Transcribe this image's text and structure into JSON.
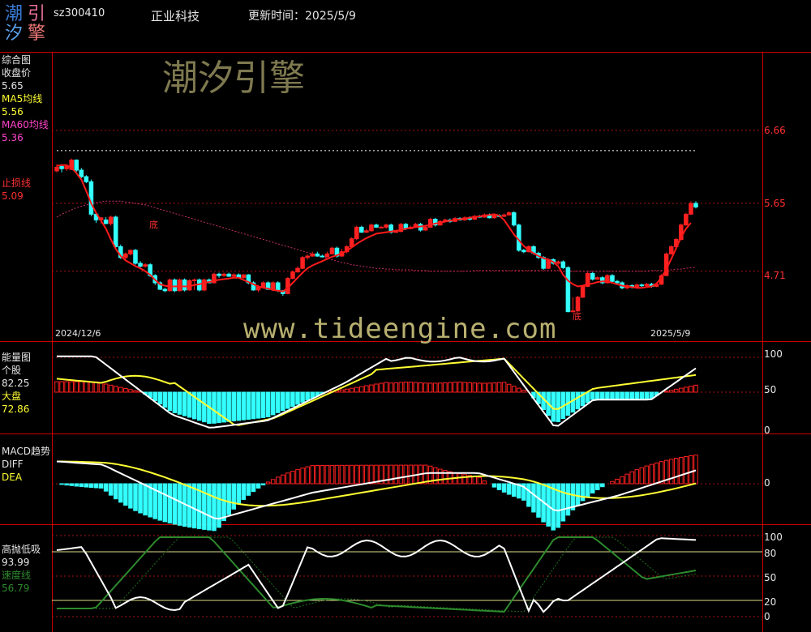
{
  "header": {
    "logo": {
      "c1": "潮",
      "c2": "引",
      "c3": "汐",
      "c4": "擎"
    },
    "code": "sz300410",
    "name": "正业科技",
    "update_label": "更新时间：2025/5/9"
  },
  "watermarks": {
    "brand": "潮汐引擎",
    "url": "www.tideengine.com"
  },
  "panels": {
    "main": {
      "title": "综合图",
      "close_label": "收盘价",
      "close_value": "5.65",
      "ma5_label": "MA5均线",
      "ma5_value": "5.56",
      "ma60_label": "MA60均线",
      "ma60_value": "5.36",
      "stop_label": "止损线",
      "stop_value": "5.09",
      "yticks": [
        "6.66",
        "5.65",
        "4.71"
      ],
      "date_start": "2024/12/6",
      "date_end": "2025/5/9",
      "bottom_marks": [
        "底",
        "底"
      ]
    },
    "energy": {
      "title": "能量图",
      "stock_label": "个股",
      "stock_value": "82.25",
      "market_label": "大盘",
      "market_value": "72.86",
      "yticks": [
        "100",
        "50",
        "0"
      ]
    },
    "macd": {
      "title": "MACD趋势",
      "diff_label": "DIFF",
      "dea_label": "DEA",
      "yticks": [
        "0"
      ]
    },
    "hilo": {
      "title": "高抛低吸",
      "value": "93.99",
      "speed_label": "速度线",
      "speed_value": "56.79",
      "yticks": [
        "100",
        "80",
        "50",
        "20",
        "0"
      ]
    }
  },
  "colors": {
    "bg": "#000000",
    "up": "#ff2020",
    "down": "#33ffff",
    "frame": "#cc0000",
    "white": "#ffffff",
    "yellow": "#ffff33",
    "green": "#2d8a2d",
    "magenta": "#ff44cc"
  },
  "chart_data": {
    "type": "candlestick",
    "x_range": [
      "2024/12/6",
      "2025/5/9"
    ],
    "y_ticks": [
      4.71,
      5.65,
      6.66
    ],
    "candles": [
      [
        6.1,
        6.15,
        6.19,
        6.08
      ],
      [
        6.16,
        6.13,
        6.19,
        6.08
      ],
      [
        6.13,
        6.16,
        6.19,
        6.1
      ],
      [
        6.12,
        6.25,
        6.27,
        6.11
      ],
      [
        6.25,
        6.11,
        6.26,
        6.08
      ],
      [
        6.11,
        6.02,
        6.14,
        6.0
      ],
      [
        6.02,
        5.95,
        6.04,
        5.93
      ],
      [
        5.95,
        5.5,
        5.98,
        5.47
      ],
      [
        5.5,
        5.42,
        5.53,
        5.38
      ],
      [
        5.42,
        5.45,
        5.46,
        5.37
      ],
      [
        5.42,
        5.37,
        5.46,
        5.36
      ],
      [
        5.37,
        5.46,
        5.48,
        5.34
      ],
      [
        5.46,
        5.05,
        5.48,
        5.03
      ],
      [
        5.05,
        4.9,
        5.08,
        4.88
      ],
      [
        4.9,
        4.95,
        4.97,
        4.86
      ],
      [
        4.95,
        5.0,
        5.01,
        4.93
      ],
      [
        5.0,
        4.82,
        5.02,
        4.8
      ],
      [
        4.82,
        4.78,
        4.85,
        4.75
      ],
      [
        4.78,
        4.8,
        4.82,
        4.76
      ],
      [
        4.8,
        4.65,
        4.82,
        4.63
      ],
      [
        4.65,
        4.55,
        4.67,
        4.52
      ],
      [
        4.55,
        4.46,
        4.57,
        4.45
      ],
      [
        4.46,
        4.44,
        4.48,
        4.42
      ],
      [
        4.44,
        4.59,
        4.61,
        4.43
      ],
      [
        4.59,
        4.44,
        4.61,
        4.42
      ],
      [
        4.44,
        4.59,
        4.61,
        4.43
      ],
      [
        4.59,
        4.45,
        4.61,
        4.43
      ],
      [
        4.45,
        4.58,
        4.6,
        4.44
      ],
      [
        4.58,
        4.59,
        4.61,
        4.45
      ],
      [
        4.59,
        4.45,
        4.61,
        4.43
      ],
      [
        4.45,
        4.59,
        4.61,
        4.43
      ],
      [
        4.59,
        4.55,
        4.61,
        4.54
      ],
      [
        4.55,
        4.67,
        4.69,
        4.54
      ],
      [
        4.67,
        4.65,
        4.69,
        4.62
      ],
      [
        4.65,
        4.67,
        4.69,
        4.63
      ],
      [
        4.67,
        4.64,
        4.69,
        4.63
      ],
      [
        4.64,
        4.66,
        4.68,
        4.62
      ],
      [
        4.66,
        4.62,
        4.68,
        4.61
      ],
      [
        4.62,
        4.66,
        4.67,
        4.61
      ],
      [
        4.66,
        4.55,
        4.67,
        4.53
      ],
      [
        4.55,
        4.45,
        4.57,
        4.44
      ],
      [
        4.45,
        4.49,
        4.52,
        4.42
      ],
      [
        4.49,
        4.55,
        4.57,
        4.48
      ],
      [
        4.55,
        4.46,
        4.57,
        4.45
      ],
      [
        4.46,
        4.55,
        4.57,
        4.44
      ],
      [
        4.55,
        4.44,
        4.57,
        4.42
      ],
      [
        4.44,
        4.4,
        4.45,
        4.37
      ],
      [
        4.4,
        4.61,
        4.63,
        4.39
      ],
      [
        4.61,
        4.7,
        4.72,
        4.6
      ],
      [
        4.7,
        4.75,
        4.78,
        4.69
      ],
      [
        4.75,
        4.9,
        4.92,
        4.74
      ],
      [
        4.9,
        4.92,
        4.94,
        4.87
      ],
      [
        4.92,
        4.95,
        4.98,
        4.91
      ],
      [
        4.95,
        4.92,
        4.98,
        4.91
      ],
      [
        4.92,
        4.91,
        4.94,
        4.9
      ],
      [
        4.91,
        4.95,
        4.98,
        4.9
      ],
      [
        4.95,
        5.03,
        5.05,
        4.94
      ],
      [
        5.03,
        4.92,
        5.05,
        4.9
      ],
      [
        4.92,
        4.98,
        5.02,
        4.91
      ],
      [
        4.98,
        5.05,
        5.07,
        4.96
      ],
      [
        5.05,
        5.16,
        5.18,
        5.03
      ],
      [
        5.16,
        5.32,
        5.34,
        5.14
      ],
      [
        5.32,
        5.25,
        5.34,
        5.24
      ],
      [
        5.25,
        5.27,
        5.3,
        5.24
      ],
      [
        5.27,
        5.35,
        5.37,
        5.26
      ],
      [
        5.35,
        5.32,
        5.37,
        5.31
      ],
      [
        5.32,
        5.32,
        5.34,
        5.31
      ],
      [
        5.32,
        5.35,
        5.37,
        5.3
      ],
      [
        5.35,
        5.25,
        5.37,
        5.23
      ],
      [
        5.25,
        5.26,
        5.28,
        5.24
      ],
      [
        5.26,
        5.36,
        5.38,
        5.25
      ],
      [
        5.36,
        5.3,
        5.38,
        5.28
      ],
      [
        5.3,
        5.32,
        5.34,
        5.29
      ],
      [
        5.32,
        5.36,
        5.38,
        5.31
      ],
      [
        5.36,
        5.28,
        5.38,
        5.26
      ],
      [
        5.28,
        5.32,
        5.34,
        5.27
      ],
      [
        5.32,
        5.43,
        5.45,
        5.31
      ],
      [
        5.43,
        5.35,
        5.45,
        5.33
      ],
      [
        5.35,
        5.4,
        5.42,
        5.34
      ],
      [
        5.4,
        5.42,
        5.44,
        5.38
      ],
      [
        5.42,
        5.4,
        5.44,
        5.38
      ],
      [
        5.4,
        5.44,
        5.46,
        5.39
      ],
      [
        5.44,
        5.42,
        5.46,
        5.41
      ],
      [
        5.42,
        5.45,
        5.47,
        5.41
      ],
      [
        5.45,
        5.43,
        5.47,
        5.41
      ],
      [
        5.43,
        5.47,
        5.49,
        5.42
      ],
      [
        5.47,
        5.46,
        5.49,
        5.45
      ],
      [
        5.46,
        5.49,
        5.51,
        5.45
      ],
      [
        5.49,
        5.45,
        5.51,
        5.44
      ],
      [
        5.45,
        5.48,
        5.5,
        5.44
      ],
      [
        5.48,
        5.47,
        5.5,
        5.46
      ],
      [
        5.47,
        5.49,
        5.51,
        5.46
      ],
      [
        5.49,
        5.52,
        5.54,
        5.48
      ],
      [
        5.52,
        5.35,
        5.54,
        5.33
      ],
      [
        5.35,
        5.0,
        5.37,
        4.98
      ],
      [
        5.0,
        4.98,
        5.02,
        4.96
      ],
      [
        4.98,
        5.05,
        5.07,
        4.97
      ],
      [
        5.05,
        4.96,
        5.07,
        4.94
      ],
      [
        4.96,
        4.9,
        4.98,
        4.88
      ],
      [
        4.9,
        4.75,
        4.92,
        4.73
      ],
      [
        4.75,
        4.87,
        4.89,
        4.74
      ],
      [
        4.87,
        4.82,
        4.89,
        4.8
      ],
      [
        4.82,
        4.84,
        4.86,
        4.8
      ],
      [
        4.84,
        4.76,
        4.86,
        4.74
      ],
      [
        4.76,
        4.15,
        4.78,
        4.14
      ],
      [
        4.15,
        4.16,
        4.35,
        4.14
      ],
      [
        4.16,
        4.35,
        4.37,
        4.15
      ],
      [
        4.35,
        4.5,
        4.52,
        4.34
      ],
      [
        4.5,
        4.68,
        4.7,
        4.49
      ],
      [
        4.68,
        4.6,
        4.7,
        4.58
      ],
      [
        4.6,
        4.62,
        4.64,
        4.59
      ],
      [
        4.62,
        4.55,
        4.64,
        4.53
      ],
      [
        4.55,
        4.65,
        4.67,
        4.54
      ],
      [
        4.65,
        4.57,
        4.67,
        4.55
      ],
      [
        4.57,
        4.55,
        4.59,
        4.53
      ],
      [
        4.55,
        4.48,
        4.57,
        4.46
      ],
      [
        4.48,
        4.51,
        4.53,
        4.46
      ],
      [
        4.51,
        4.49,
        4.53,
        4.47
      ],
      [
        4.49,
        4.52,
        4.54,
        4.48
      ],
      [
        4.52,
        4.51,
        4.54,
        4.49
      ],
      [
        4.51,
        4.53,
        4.55,
        4.49
      ],
      [
        4.53,
        4.5,
        4.55,
        4.48
      ],
      [
        4.5,
        4.53,
        4.55,
        4.49
      ],
      [
        4.53,
        4.65,
        4.67,
        4.52
      ],
      [
        4.65,
        4.95,
        4.97,
        4.64
      ],
      [
        4.95,
        5.05,
        5.07,
        4.94
      ],
      [
        5.05,
        5.15,
        5.17,
        5.04
      ],
      [
        5.15,
        5.35,
        5.37,
        5.14
      ],
      [
        5.35,
        5.5,
        5.52,
        5.34
      ],
      [
        5.5,
        5.65,
        5.68,
        5.49
      ],
      [
        5.65,
        5.6,
        5.68,
        5.58
      ]
    ],
    "ma5": [
      6.17,
      6.18,
      6.18,
      6.14,
      6.07,
      5.98,
      5.82,
      5.65,
      5.52,
      5.41,
      5.3,
      5.15,
      5.02,
      4.92,
      4.86,
      4.82,
      4.78,
      4.75,
      4.71,
      4.66,
      4.59,
      4.53,
      4.51,
      4.5,
      4.5,
      4.5,
      4.5,
      4.5,
      4.52,
      4.53,
      4.55,
      4.56,
      4.58,
      4.59,
      4.6,
      4.61,
      4.62,
      4.62,
      4.59,
      4.56,
      4.53,
      4.5,
      4.48,
      4.47,
      4.45,
      4.44,
      4.43,
      4.48,
      4.55,
      4.62,
      4.69,
      4.75,
      4.79,
      4.82,
      4.85,
      4.88,
      4.91,
      4.93,
      4.96,
      4.99,
      5.04,
      5.09,
      5.13,
      5.17,
      5.2,
      5.23,
      5.24,
      5.25,
      5.26,
      5.27,
      5.28,
      5.3,
      5.31,
      5.32,
      5.33,
      5.34,
      5.35,
      5.37,
      5.38,
      5.4,
      5.41,
      5.42,
      5.43,
      5.44,
      5.45,
      5.46,
      5.47,
      5.48,
      5.49,
      5.5,
      5.48,
      5.42,
      5.32,
      5.22,
      5.14,
      5.06,
      5.0,
      4.96,
      4.92,
      4.89,
      4.87,
      4.84,
      4.78,
      4.66,
      4.58,
      4.53,
      4.5,
      4.51,
      4.53,
      4.54,
      4.56,
      4.57,
      4.57,
      4.55,
      4.53,
      4.51,
      4.5,
      4.49,
      4.48,
      4.48,
      4.49,
      4.5,
      4.54,
      4.62,
      4.74,
      4.88,
      5.03,
      5.18,
      5.3,
      5.38
    ],
    "ma60": [
      5.46,
      5.5,
      5.53,
      5.56,
      5.59,
      5.61,
      5.63,
      5.64,
      5.66,
      5.67,
      5.68,
      5.68,
      5.68,
      5.68,
      5.67,
      5.66,
      5.65,
      5.64,
      5.63,
      5.61,
      5.59,
      5.57,
      5.55,
      5.53,
      5.51,
      5.49,
      5.47,
      5.45,
      5.43,
      5.41,
      5.39,
      5.37,
      5.35,
      5.33,
      5.31,
      5.29,
      5.27,
      5.25,
      5.23,
      5.21,
      5.19,
      5.17,
      5.15,
      5.13,
      5.11,
      5.09,
      5.07,
      5.05,
      5.03,
      5.01,
      4.99,
      4.97,
      4.95,
      4.93,
      4.91,
      4.89,
      4.87,
      4.85,
      4.83,
      4.82,
      4.8,
      4.79,
      4.78,
      4.77,
      4.76,
      4.75,
      4.75,
      4.74,
      4.74,
      4.73,
      4.73,
      4.73,
      4.73,
      4.72,
      4.72,
      4.72,
      4.71,
      4.71,
      4.71,
      4.71,
      4.71,
      4.71,
      4.71,
      4.71,
      4.71,
      4.72,
      4.72,
      4.72,
      4.72,
      4.72,
      4.72,
      4.72,
      4.72,
      4.72,
      4.72,
      4.72,
      4.72,
      4.72,
      4.72,
      4.72,
      4.72,
      4.72,
      4.72,
      4.71,
      4.71,
      4.71,
      4.71,
      4.71,
      4.71,
      4.71,
      4.71,
      4.71,
      4.71,
      4.71,
      4.71,
      4.71,
      4.71,
      4.71,
      4.71,
      4.71,
      4.71,
      4.72,
      4.72,
      4.72,
      4.72,
      4.73,
      4.74,
      4.74,
      4.75,
      4.76,
      4.76
    ],
    "stop": [
      6.38,
      6.38,
      6.38,
      6.38,
      6.38,
      6.38,
      6.38,
      6.38,
      6.38,
      6.38,
      6.38,
      6.38,
      6.38,
      6.38,
      6.38,
      6.38,
      6.38,
      6.38,
      6.38,
      6.38,
      6.38,
      6.38,
      6.38,
      6.38,
      6.38,
      6.38,
      6.38,
      6.38,
      6.38,
      6.38,
      6.38,
      6.38,
      6.38,
      6.38,
      6.38,
      6.38,
      6.38,
      6.38,
      6.38,
      6.38,
      6.38,
      6.38,
      6.38,
      6.38,
      6.38,
      6.38,
      6.38,
      6.38,
      6.38,
      6.38,
      6.38,
      6.38,
      6.38,
      6.38,
      6.38,
      6.38,
      6.38,
      6.38,
      6.38,
      6.38,
      6.38,
      6.38,
      6.38,
      6.38,
      6.38,
      6.38,
      6.38,
      6.38,
      6.38,
      6.38,
      6.38,
      6.38,
      6.38,
      6.38,
      6.38,
      6.38,
      6.38,
      6.38,
      6.38,
      6.38,
      6.38,
      6.38,
      6.38,
      6.38,
      6.38,
      6.38,
      6.38,
      6.38,
      6.38,
      6.38,
      6.38,
      6.38,
      6.38,
      6.38,
      6.38,
      6.38,
      6.38,
      6.38,
      6.38,
      6.38,
      6.38,
      6.38,
      6.38,
      6.38,
      6.38,
      6.38,
      6.38,
      6.38,
      6.38,
      6.38,
      6.38,
      6.38,
      6.38,
      6.38,
      6.38,
      6.38,
      6.38,
      6.38,
      6.38,
      6.38,
      6.38,
      6.38,
      6.38,
      6.38,
      6.38,
      6.38,
      6.38,
      6.38,
      6.38,
      6.38,
      6.38
    ]
  }
}
